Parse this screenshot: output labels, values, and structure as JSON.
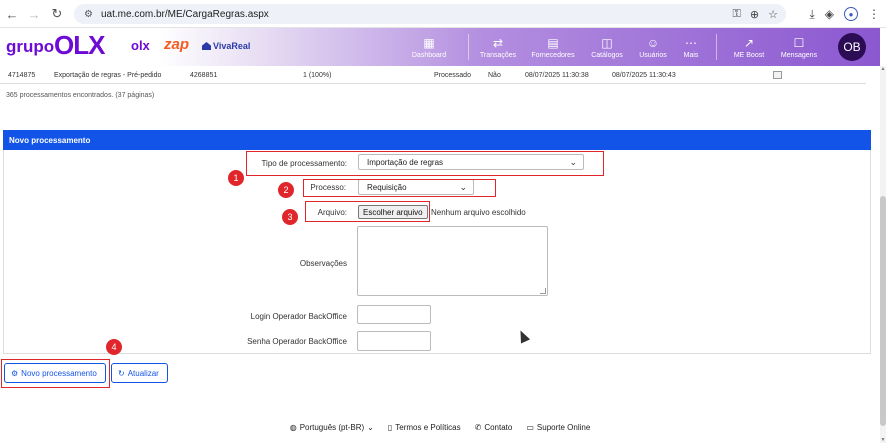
{
  "browser": {
    "url": "uat.me.com.br/ME/CargaRegras.aspx"
  },
  "header": {
    "logo_grupo": "grupo",
    "logo_olx": "OLX",
    "logo_olx_small": "olx",
    "logo_zap": "zap",
    "logo_vivareal": "VivaReal",
    "nav": [
      {
        "label": "Dashboard",
        "icon": "grid-icon"
      },
      {
        "label": "Transações",
        "icon": "exchange-icon"
      },
      {
        "label": "Fornecedores",
        "icon": "store-icon"
      },
      {
        "label": "Catálogos",
        "icon": "bag-icon"
      },
      {
        "label": "Usuários",
        "icon": "users-icon"
      },
      {
        "label": "Mais",
        "icon": "more-icon"
      },
      {
        "label": "ME Boost",
        "icon": "chart-icon"
      },
      {
        "label": "Mensagens",
        "icon": "chat-icon"
      }
    ],
    "avatar_initials": "OB"
  },
  "results": {
    "row": {
      "id": "4714875",
      "description": "Exportação de regras - Pré-pedido",
      "code": "4268851",
      "progress": "1 (100%)",
      "status": "Processado",
      "flag": "Não",
      "start": "08/07/2025 11:30:38",
      "end": "08/07/2025 11:30:43"
    },
    "count_text": "365 processamentos encontrados. (37 páginas)"
  },
  "panel": {
    "title": "Novo processamento",
    "tipo_label": "Tipo de processamento:",
    "tipo_value": "Importação de regras",
    "processo_label": "Processo:",
    "processo_value": "Requisição",
    "arquivo_label": "Arquivo:",
    "arquivo_button": "Escolher arquivo",
    "arquivo_none": "Nenhum arquivo escolhido",
    "observacoes_label": "Observações",
    "login_label": "Login Operador BackOffice",
    "senha_label": "Senha Operador BackOffice"
  },
  "annotations": {
    "badge1": "1",
    "badge2": "2",
    "badge3": "3",
    "badge4": "4"
  },
  "actions": {
    "novo_label": "Novo processamento",
    "atualizar_label": "Atualizar"
  },
  "footer": {
    "language": "Português (pt-BR)",
    "terms": "Termos e Políticas",
    "contact": "Contato",
    "support": "Suporte Online"
  },
  "colors": {
    "brand_purple": "#6e0ad6",
    "panel_blue": "#1354e8",
    "annotation_red": "#e0262b"
  }
}
